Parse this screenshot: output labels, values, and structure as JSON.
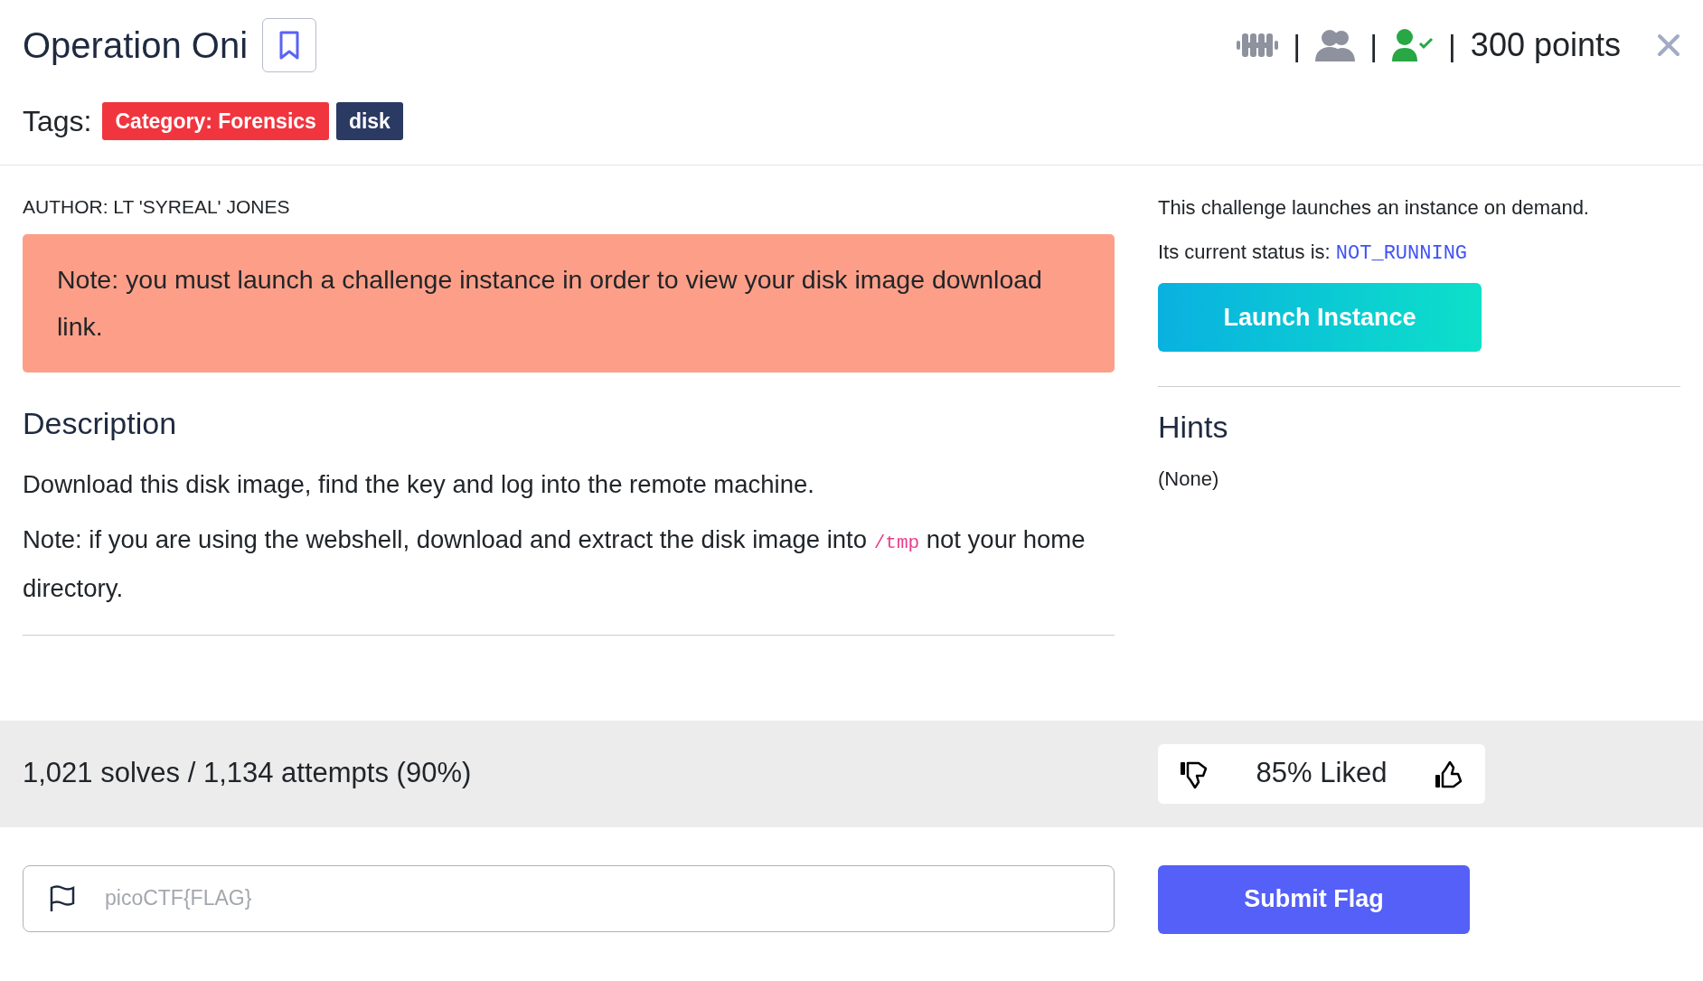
{
  "title": "Operation Oni",
  "header_stats": [
    {
      "kind": "dumbbell"
    },
    {
      "kind": "separator",
      "text": "|"
    },
    {
      "kind": "team"
    },
    {
      "kind": "separator",
      "text": "|"
    },
    {
      "kind": "solved",
      "solved": true
    },
    {
      "kind": "separator",
      "text": "|"
    },
    {
      "kind": "points",
      "text": "300 points"
    }
  ],
  "tags_label": "Tags:",
  "tags": [
    {
      "text": "Category: Forensics",
      "color": "#f0353f"
    },
    {
      "text": "disk",
      "color": "#2b3a62"
    }
  ],
  "author": "AUTHOR: LT 'SYREAL' JONES",
  "alert": "Note: you must launch a challenge instance in order to view your disk image download link.",
  "description": {
    "heading": "Description",
    "paragraphs": [
      [
        {
          "text": "Download this disk image, find the key and log into the remote machine."
        }
      ],
      [
        {
          "text": "Note: if you are using the webshell, download and extract the disk image into "
        },
        {
          "kind": "code",
          "text": "/tmp"
        },
        {
          "text": " not your home directory."
        }
      ]
    ]
  },
  "instance": {
    "intro": "This challenge launches an instance on demand.",
    "status": [
      {
        "text": "Its current status is: "
      },
      {
        "kind": "status",
        "text": "NOT_RUNNING"
      }
    ],
    "button": "Launch Instance"
  },
  "hints": {
    "heading": "Hints",
    "text": "(None)"
  },
  "stats": "1,021 solves / 1,134 attempts (90%)",
  "likes": "85% Liked",
  "flag": {
    "placeholder": "picoCTF{FLAG}",
    "button": "Submit Flag"
  }
}
